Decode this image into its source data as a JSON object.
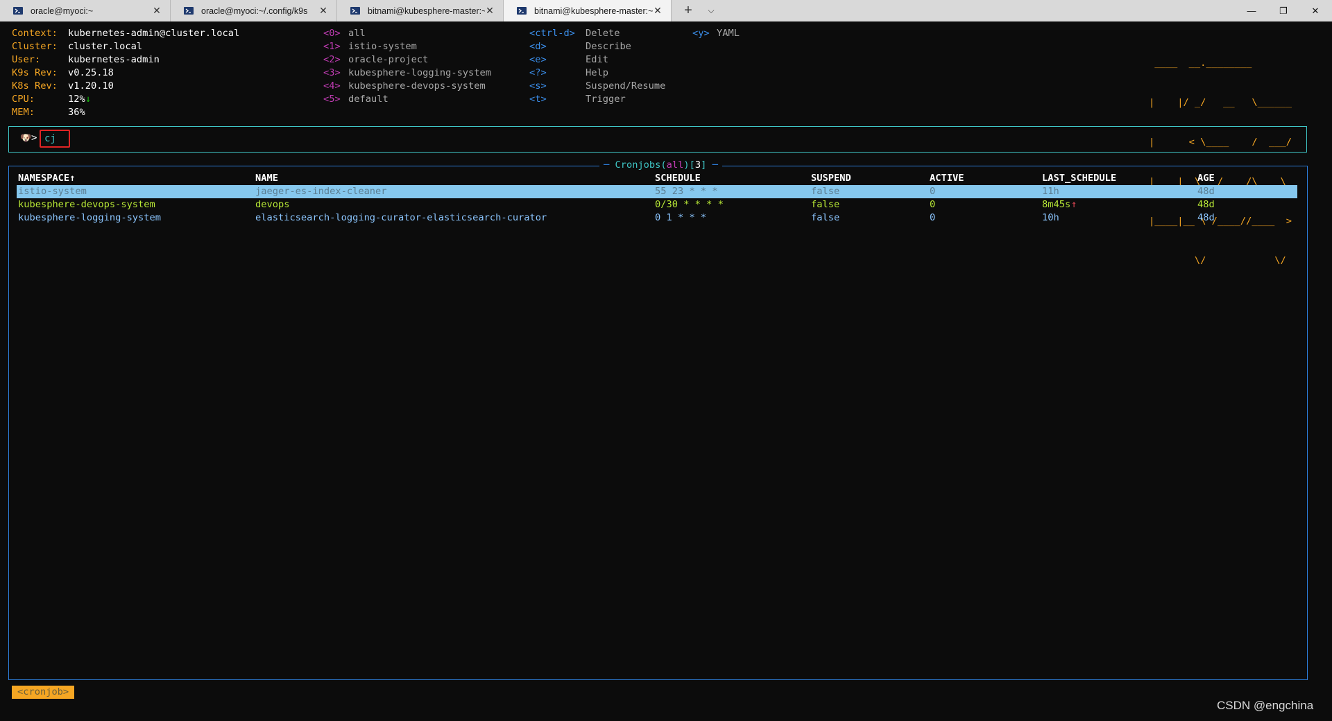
{
  "tabs": [
    {
      "title": "oracle@myoci:~",
      "icon": "powershell-icon",
      "active": false
    },
    {
      "title": "oracle@myoci:~/.config/k9s",
      "icon": "powershell-icon",
      "active": false
    },
    {
      "title": "bitnami@kubesphere-master:~",
      "icon": "powershell-icon",
      "active": false
    },
    {
      "title": "bitnami@kubesphere-master:~",
      "icon": "powershell-icon",
      "active": true
    }
  ],
  "window_controls": {
    "new_tab": "+",
    "dropdown": "⌵",
    "minimize": "—",
    "restore": "❐",
    "close": "✕"
  },
  "info": [
    {
      "label": "Context:",
      "value": "kubernetes-admin@cluster.local"
    },
    {
      "label": "Cluster:",
      "value": "cluster.local"
    },
    {
      "label": "User:",
      "value": "kubernetes-admin"
    },
    {
      "label": "K9s Rev:",
      "value": "v0.25.18"
    },
    {
      "label": "K8s Rev:",
      "value": "v1.20.10"
    },
    {
      "label": "CPU:",
      "value": "12%",
      "trend": "↓"
    },
    {
      "label": "MEM:",
      "value": "36%"
    }
  ],
  "namespaces": [
    {
      "key": "<0>",
      "name": "all"
    },
    {
      "key": "<1>",
      "name": "istio-system"
    },
    {
      "key": "<2>",
      "name": "oracle-project"
    },
    {
      "key": "<3>",
      "name": "kubesphere-logging-system"
    },
    {
      "key": "<4>",
      "name": "kubesphere-devops-system"
    },
    {
      "key": "<5>",
      "name": "default"
    }
  ],
  "shortcuts": [
    {
      "key": "<ctrl-d>",
      "action": "Delete"
    },
    {
      "key": "<d>",
      "action": "Describe"
    },
    {
      "key": "<e>",
      "action": "Edit"
    },
    {
      "key": "<?>",
      "action": "Help"
    },
    {
      "key": "<s>",
      "action": "Suspend/Resume"
    },
    {
      "key": "<t>",
      "action": "Trigger"
    }
  ],
  "shortcuts2": [
    {
      "key": "<y>",
      "action": "YAML"
    }
  ],
  "logo_lines": [
    " ____  __.________       ",
    "|    |/ _/   __   \\______",
    "|      < \\____    /  ___/",
    "|    |  \\   /    /\\___ \\ ",
    "|____|__ \\ /____//____  >",
    "        \\/            \\/ "
  ],
  "prompt": {
    "icon": "dog-icon",
    "symbol": ">",
    "command": "cj"
  },
  "table": {
    "resource": "Cronjobs",
    "scope": "all",
    "count": "3",
    "headers": [
      "NAMESPACE↑",
      "NAME",
      "SCHEDULE",
      "SUSPEND",
      "ACTIVE",
      "LAST_SCHEDULE",
      "AGE"
    ],
    "rows": [
      {
        "cells": [
          "istio-system",
          "jaeger-es-index-cleaner",
          "55 23 * * *",
          "false",
          "0",
          "11h",
          "48d"
        ],
        "selected": true
      },
      {
        "cells": [
          "kubesphere-devops-system",
          "devops",
          "0/30 * * * *",
          "false",
          "0",
          "8m45s",
          "48d"
        ],
        "last_trend": "↑"
      },
      {
        "cells": [
          "kubesphere-logging-system",
          "elasticsearch-logging-curator-elasticsearch-curator",
          "0 1 * * *",
          "false",
          "0",
          "10h",
          "48d"
        ]
      }
    ]
  },
  "breadcrumb": "<cronjob>",
  "watermark": "CSDN @engchina",
  "colors": {
    "accent_orange": "#f5a623",
    "border_blue": "#2d7fdc",
    "prompt_cyan": "#3fc6c6",
    "selected_row": "#86c8ee",
    "row_green": "#b8e836",
    "row_blue": "#8cc6ff"
  }
}
